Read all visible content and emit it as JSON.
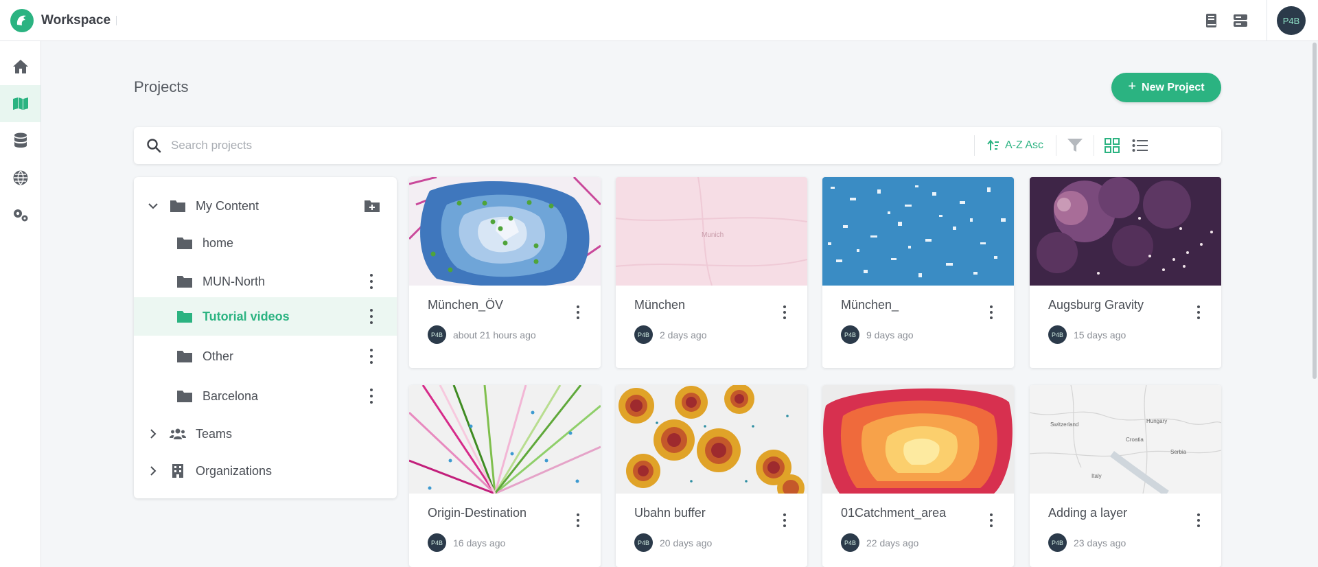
{
  "app": {
    "title": "Workspace"
  },
  "user": {
    "initials": "P4B"
  },
  "page": {
    "title": "Projects"
  },
  "actions": {
    "new_project": "New Project"
  },
  "search": {
    "placeholder": "Search projects"
  },
  "sort": {
    "label": "A-Z Asc"
  },
  "sidebar": {
    "items": [
      {
        "name": "home",
        "icon": "home-icon"
      },
      {
        "name": "projects",
        "icon": "map-icon",
        "active": true
      },
      {
        "name": "datasets",
        "icon": "database-icon"
      },
      {
        "name": "catalog",
        "icon": "globe-icon"
      },
      {
        "name": "settings",
        "icon": "gears-icon"
      }
    ]
  },
  "tree": {
    "root": "My Content",
    "folders": [
      "home",
      "MUN-North",
      "Tutorial videos",
      "Other",
      "Barcelona"
    ],
    "selected": "Tutorial videos",
    "teams": "Teams",
    "organizations": "Organizations"
  },
  "projects": [
    {
      "title": "München_ÖV",
      "updated": "about 21 hours ago"
    },
    {
      "title": "München",
      "updated": "2 days ago"
    },
    {
      "title": "München_",
      "updated": "9 days ago"
    },
    {
      "title": "Augsburg Gravity",
      "updated": "15 days ago"
    },
    {
      "title": "Origin-Destination",
      "updated": "16 days ago"
    },
    {
      "title": "Ubahn buffer",
      "updated": "20 days ago"
    },
    {
      "title": "01Catchment_area",
      "updated": "22 days ago"
    },
    {
      "title": "Adding a layer",
      "updated": "23 days ago"
    }
  ],
  "map_labels": {
    "munich": "Munich",
    "hungary": "Hungary",
    "switzerland": "Switzerland",
    "croatia": "Croatia",
    "serbia": "Serbia",
    "italy": "Italy"
  },
  "colors": {
    "accent": "#2bb381",
    "avatar": "#2b3a4a"
  }
}
